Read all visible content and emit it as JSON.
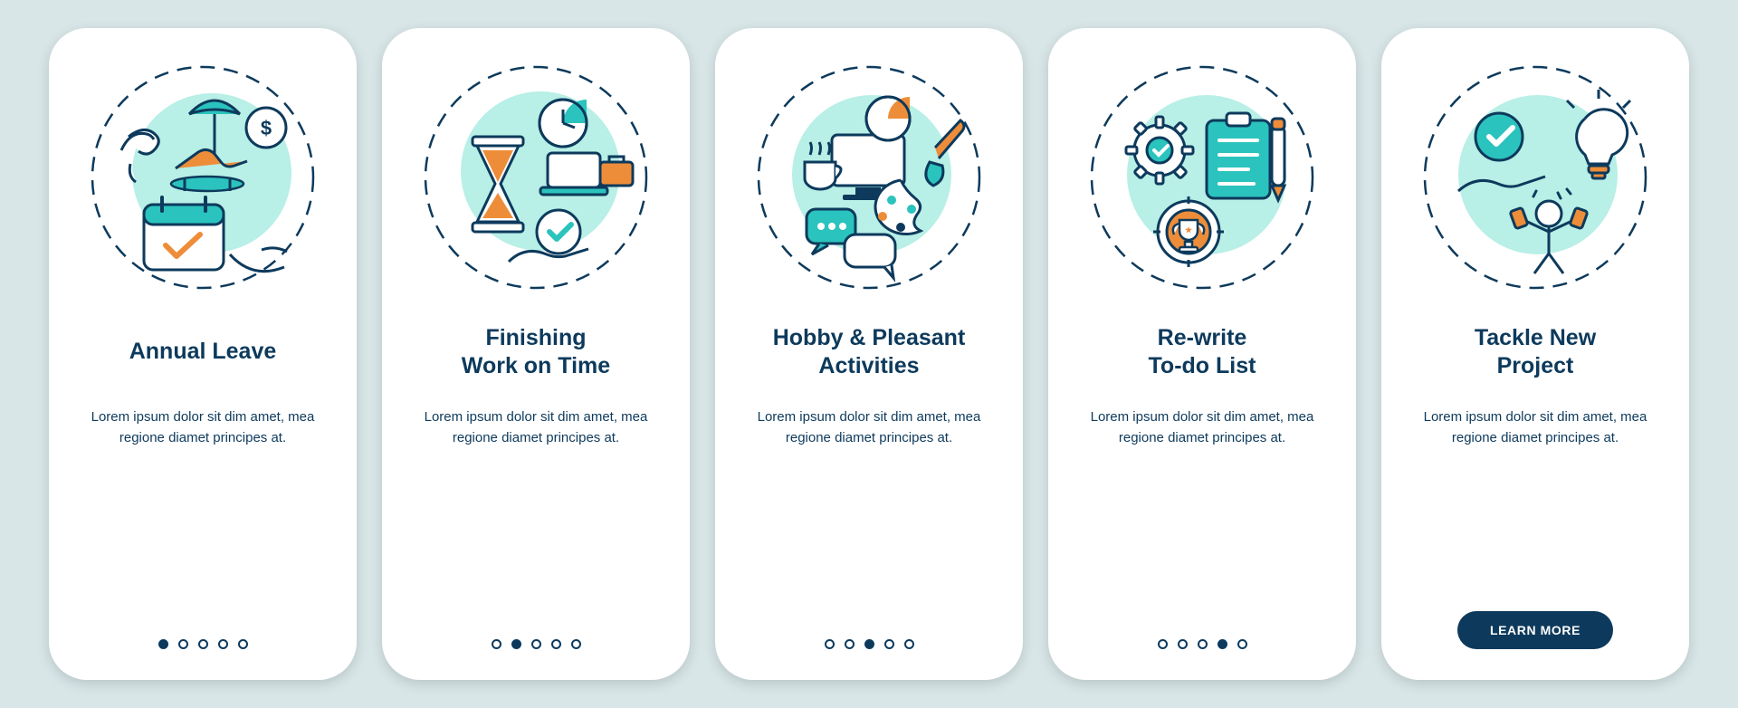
{
  "total_slides": 5,
  "slides": [
    {
      "title": "Annual Leave",
      "body": "Lorem ipsum dolor sit dim amet, mea regione diamet principes at.",
      "icon": "annual-leave-icon",
      "active_index": 0
    },
    {
      "title": "Finishing\nWork on Time",
      "body": "Lorem ipsum dolor sit dim amet, mea regione diamet principes at.",
      "icon": "finishing-work-icon",
      "active_index": 1
    },
    {
      "title": "Hobby & Pleasant\nActivities",
      "body": "Lorem ipsum dolor sit dim amet, mea regione diamet principes at.",
      "icon": "hobby-icon",
      "active_index": 2
    },
    {
      "title": "Re-write\nTo-do List",
      "body": "Lorem ipsum dolor sit dim amet, mea regione diamet principes at.",
      "icon": "todo-list-icon",
      "active_index": 3
    },
    {
      "title": "Tackle New\nProject",
      "body": "Lorem ipsum dolor sit dim amet, mea regione diamet principes at.",
      "icon": "new-project-icon",
      "active_index": 4,
      "cta": "LEARN MORE"
    }
  ],
  "palette": {
    "bg": "#d8e6e8",
    "card": "#ffffff",
    "ink": "#0d3a5c",
    "teal": "#2bc3bd",
    "mint": "#b8efe6",
    "orange": "#ee8d39"
  }
}
